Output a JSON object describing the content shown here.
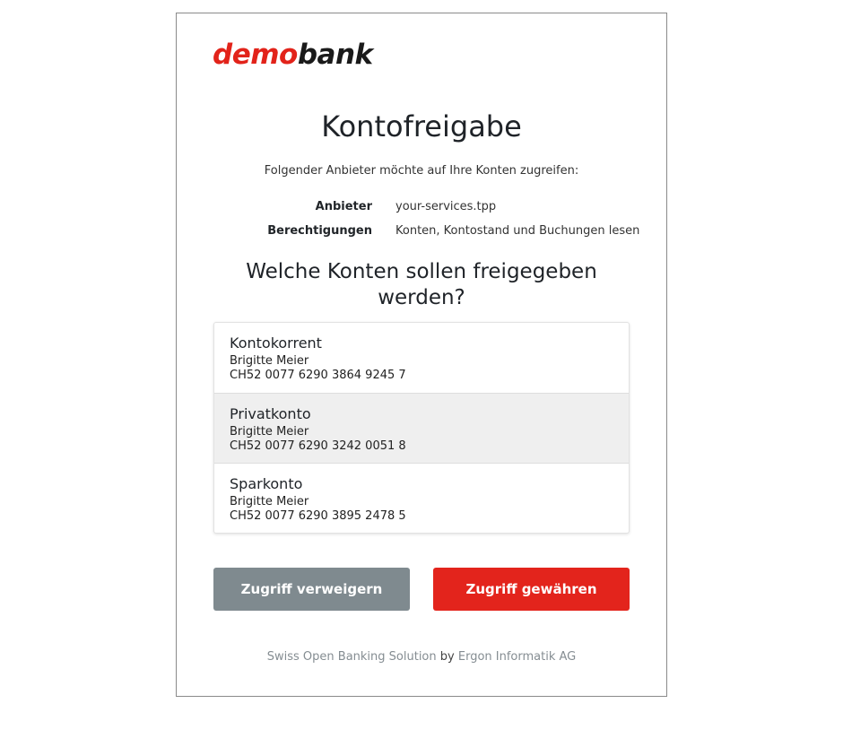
{
  "logo": {
    "part1": "demo",
    "part2": "bank"
  },
  "page": {
    "title": "Kontofreigabe",
    "subtitle": "Folgender Anbieter möchte auf Ihre Konten zugreifen:"
  },
  "info": {
    "provider_label": "Anbieter",
    "provider_value": "your-services.tpp",
    "permissions_label": "Berechtigungen",
    "permissions_value": "Konten, Kontostand und Buchungen lesen"
  },
  "question": "Welche Konten sollen freigegeben werden?",
  "accounts": [
    {
      "name": "Kontokorrent",
      "owner": "Brigitte Meier",
      "iban": "CH52 0077 6290 3864 9245 7",
      "selected": false
    },
    {
      "name": "Privatkonto",
      "owner": "Brigitte Meier",
      "iban": "CH52 0077 6290 3242 0051 8",
      "selected": true
    },
    {
      "name": "Sparkonto",
      "owner": "Brigitte Meier",
      "iban": "CH52 0077 6290 3895 2478 5",
      "selected": false
    }
  ],
  "buttons": {
    "deny_label": "Zugriff verweigern",
    "grant_label": "Zugriff gewähren"
  },
  "footer": {
    "link1": "Swiss Open Banking Solution",
    "separator": "by",
    "link2": "Ergon Informatik AG"
  },
  "colors": {
    "brand_red": "#e3241c",
    "deny_gray": "#7f8a8f",
    "selected_bg": "#efefef"
  }
}
